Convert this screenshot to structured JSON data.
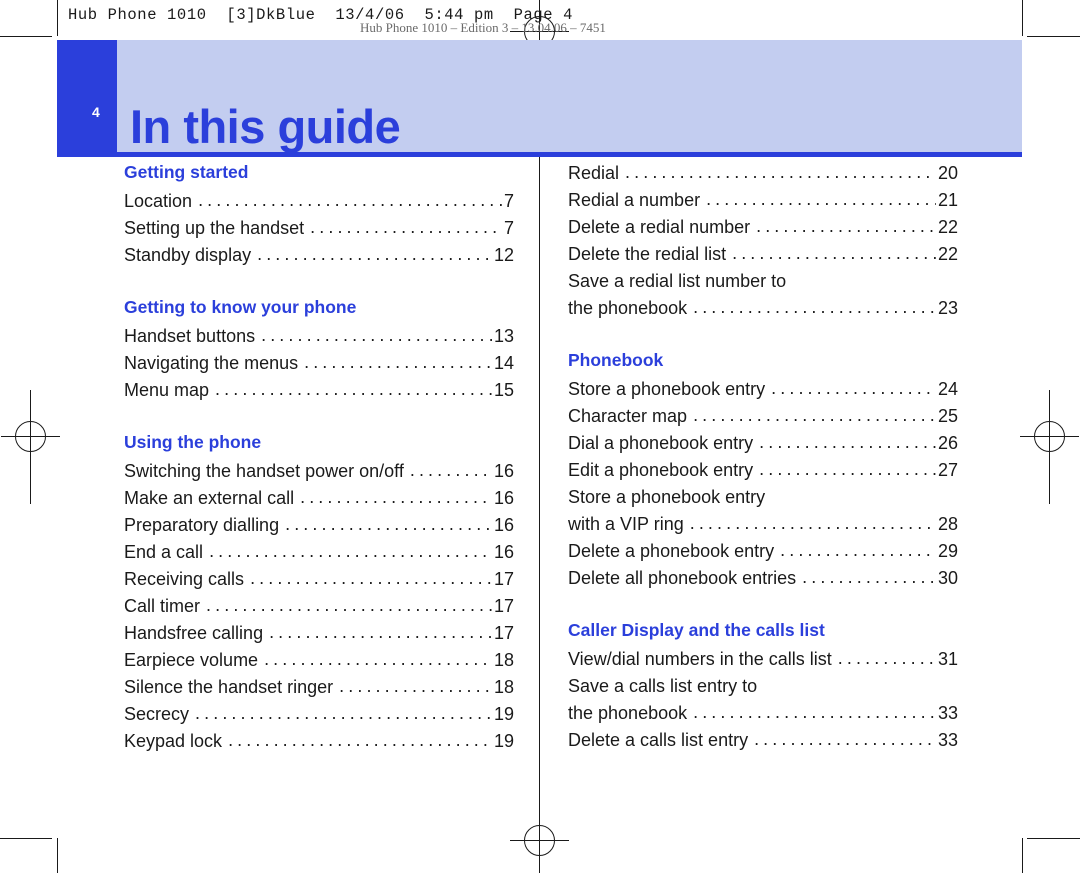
{
  "printer": {
    "slug": "Hub Phone 1010  [3]DkBlue  13/4/06  5:44 pm  Page 4",
    "edition": "Hub Phone 1010 – Edition 3 – 13.04.06 – 7451"
  },
  "banner": {
    "folio": "4",
    "title": "In this guide"
  },
  "toc": {
    "left_column": [
      {
        "heading": "Getting started",
        "entries": [
          {
            "title": "Location",
            "page": "7"
          },
          {
            "title": "Setting up the handset",
            "page": "7"
          },
          {
            "title": "Standby display",
            "page": "12"
          }
        ]
      },
      {
        "heading": "Getting to know your phone",
        "entries": [
          {
            "title": "Handset buttons",
            "page": "13"
          },
          {
            "title": "Navigating the menus",
            "page": "14"
          },
          {
            "title": "Menu map",
            "page": "15"
          }
        ]
      },
      {
        "heading": "Using the phone",
        "entries": [
          {
            "title": "Switching the handset power on/off",
            "page": "16"
          },
          {
            "title": "Make an external call",
            "page": "16"
          },
          {
            "title": "Preparatory dialling",
            "page": "16"
          },
          {
            "title": "End a call",
            "page": "16"
          },
          {
            "title": "Receiving calls",
            "page": "17"
          },
          {
            "title": "Call timer",
            "page": "17"
          },
          {
            "title": "Handsfree calling",
            "page": "17"
          },
          {
            "title": "Earpiece volume",
            "page": "18"
          },
          {
            "title": "Silence the handset ringer",
            "page": "18"
          },
          {
            "title": "Secrecy",
            "page": "19"
          },
          {
            "title": "Keypad lock",
            "page": "19"
          }
        ]
      }
    ],
    "right_column": [
      {
        "heading": "",
        "entries": [
          {
            "title": "Redial",
            "page": "20"
          },
          {
            "title": "Redial a number",
            "page": "21"
          },
          {
            "title": "Delete a redial number",
            "page": "22"
          },
          {
            "title": "Delete the redial list",
            "page": "22"
          },
          {
            "title": "Save a redial list number to",
            "page": ""
          },
          {
            "title": "the phonebook",
            "page": "23"
          }
        ]
      },
      {
        "heading": "Phonebook",
        "entries": [
          {
            "title": "Store a phonebook entry",
            "page": "24"
          },
          {
            "title": "Character map",
            "page": "25"
          },
          {
            "title": "Dial a phonebook entry",
            "page": "26"
          },
          {
            "title": "Edit a phonebook entry",
            "page": "27"
          },
          {
            "title": "Store a phonebook entry",
            "page": ""
          },
          {
            "title": "with a VIP ring",
            "page": "28"
          },
          {
            "title": "Delete a phonebook entry",
            "page": "29"
          },
          {
            "title": "Delete all phonebook entries",
            "page": "30"
          }
        ]
      },
      {
        "heading": "Caller Display and the calls list",
        "entries": [
          {
            "title": "View/dial numbers in the calls list",
            "page": "31"
          },
          {
            "title": "Save a calls list entry to",
            "page": ""
          },
          {
            "title": "the phonebook",
            "page": "33"
          },
          {
            "title": "Delete a calls list entry",
            "page": "33"
          }
        ]
      }
    ]
  },
  "colors": {
    "accent": "#2b3fdb",
    "banner_tint": "#c3cdf0",
    "text": "#1a1a1a"
  }
}
